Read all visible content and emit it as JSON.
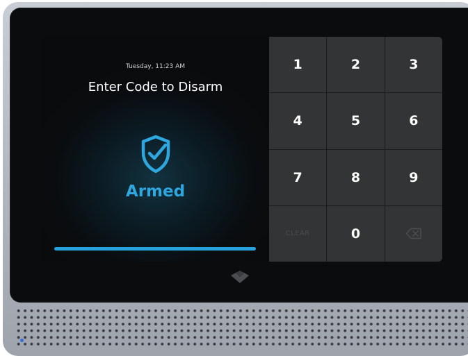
{
  "display": {
    "datetime": "Tuesday, 11:23 AM",
    "prompt": "Enter Code to Disarm",
    "status": "Armed",
    "status_icon": "shield-check-icon",
    "accent_color": "#2ea6de",
    "countdown_progress": 1.0
  },
  "keypad": {
    "keys": [
      "1",
      "2",
      "3",
      "4",
      "5",
      "6",
      "7",
      "8",
      "9",
      "CLEAR",
      "0",
      "backspace"
    ],
    "clear_label": "CLEAR",
    "backspace_icon": "backspace-icon"
  },
  "device": {
    "logo_icon": "brand-logo-icon",
    "indicator_color": "#2f6de0"
  }
}
